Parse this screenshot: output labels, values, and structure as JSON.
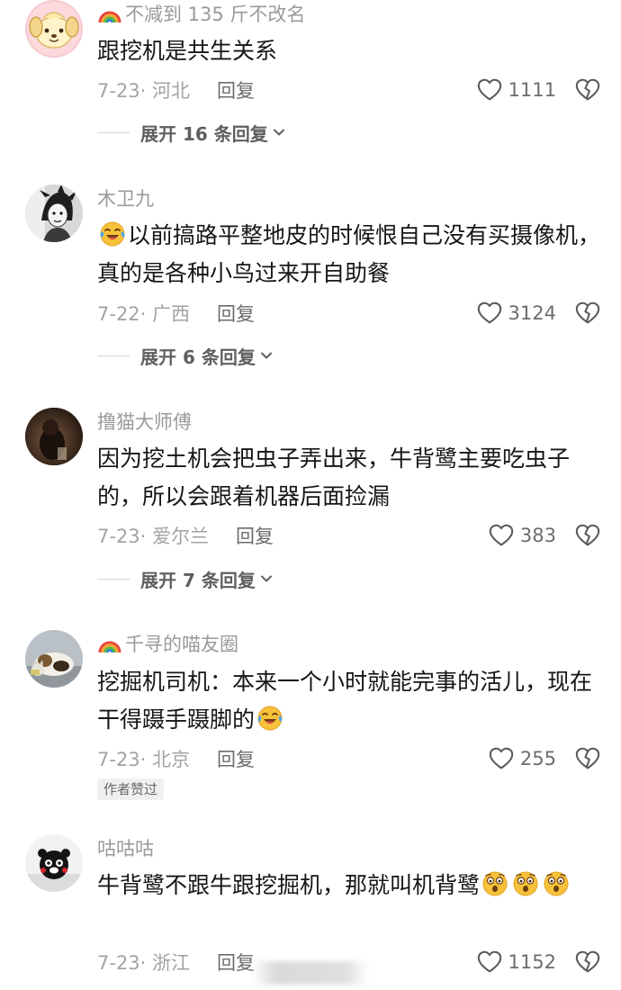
{
  "comments": [
    {
      "username": "不减到 135 斤不改名",
      "has_rainbow": true,
      "text": "跟挖机是共生关系",
      "date": "7-23",
      "location": "河北",
      "reply_label": "回复",
      "likes": "1111",
      "expand_label": "展开 16 条回复",
      "avatar_icon": "cartoon-dog-avatar"
    },
    {
      "username": "木卫九",
      "has_rainbow": false,
      "text_lead_emoji": "laughing-tears-emoji",
      "text": "以前搞路平整地皮的时候恨自己没有买摄像机，真的是各种小鸟过来开自助餐",
      "date": "7-22",
      "location": "广西",
      "reply_label": "回复",
      "likes": "3124",
      "expand_label": "展开 6 条回复",
      "avatar_icon": "anime-character-avatar"
    },
    {
      "username": "撸猫大师傅",
      "has_rainbow": false,
      "text": "因为挖土机会把虫子弄出来，牛背鹭主要吃虫子的，所以会跟着机器后面捡漏",
      "date": "7-23",
      "location": "爱尔兰",
      "reply_label": "回复",
      "likes": "383",
      "expand_label": "展开 7 条回复",
      "avatar_icon": "dark-photo-avatar"
    },
    {
      "username": "千寻的喵友圈",
      "has_rainbow": true,
      "text": "挖掘机司机：本来一个小时就能完事的活儿，现在干得蹑手蹑脚的",
      "text_trail_emoji": "laughing-tears-emoji",
      "date": "7-23",
      "location": "北京",
      "reply_label": "回复",
      "likes": "255",
      "badge": "作者赞过",
      "avatar_icon": "cat-photo-avatar"
    },
    {
      "username": "咕咕咕",
      "has_rainbow": false,
      "text": "牛背鹭不跟牛跟挖掘机，那就叫机背鹭",
      "text_trail_emoji": "shocked-face-emoji",
      "date": "7-23",
      "location": "浙江",
      "reply_label": "回复",
      "likes": "1152",
      "avatar_icon": "kumamon-avatar"
    }
  ],
  "colors": {
    "meta_gray": "#a3a3a3",
    "username_gray": "#9a9a9a",
    "text": "#161616",
    "emoji_yellow": "#f7c23a"
  }
}
